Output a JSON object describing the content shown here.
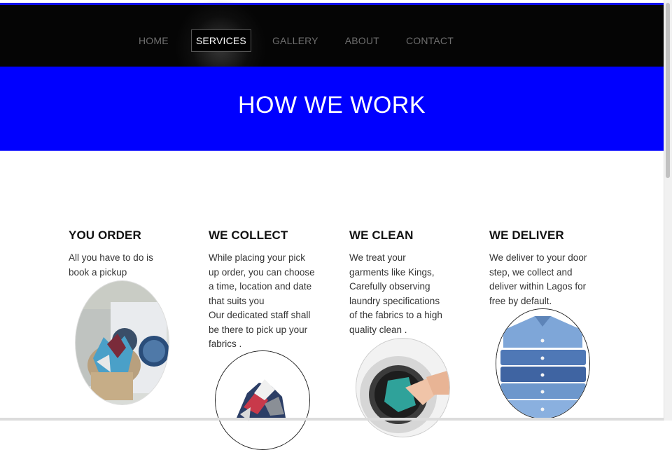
{
  "nav": {
    "items": [
      "HOME",
      "SERVICES",
      "GALLERY",
      "ABOUT",
      "CONTACT"
    ],
    "active": "SERVICES"
  },
  "hero": {
    "title": "HOW WE WORK"
  },
  "steps": [
    {
      "title": "YOU ORDER",
      "text": "All you have to do is book a pickup",
      "image": "laundry-basket-washing-machine"
    },
    {
      "title": "WE COLLECT",
      "text": "While placing your pick up order, you can choose a time, location and date that suits you\nOur dedicated staff shall be there to pick up your fabrics .",
      "image": "pile-of-clothes"
    },
    {
      "title": "WE CLEAN",
      "text": "We treat your garments like Kings, Carefully observing laundry specifications of the fabrics to a high quality clean .",
      "image": "hand-loading-washing-machine"
    },
    {
      "title": "WE DELIVER",
      "text": "We deliver to your door step, we collect and deliver within Lagos for free by default.",
      "image": "folded-blue-shirts"
    }
  ],
  "colors": {
    "nav_bg": "#050505",
    "hero_bg": "#0000ff",
    "accent_line": "#1010ee"
  }
}
